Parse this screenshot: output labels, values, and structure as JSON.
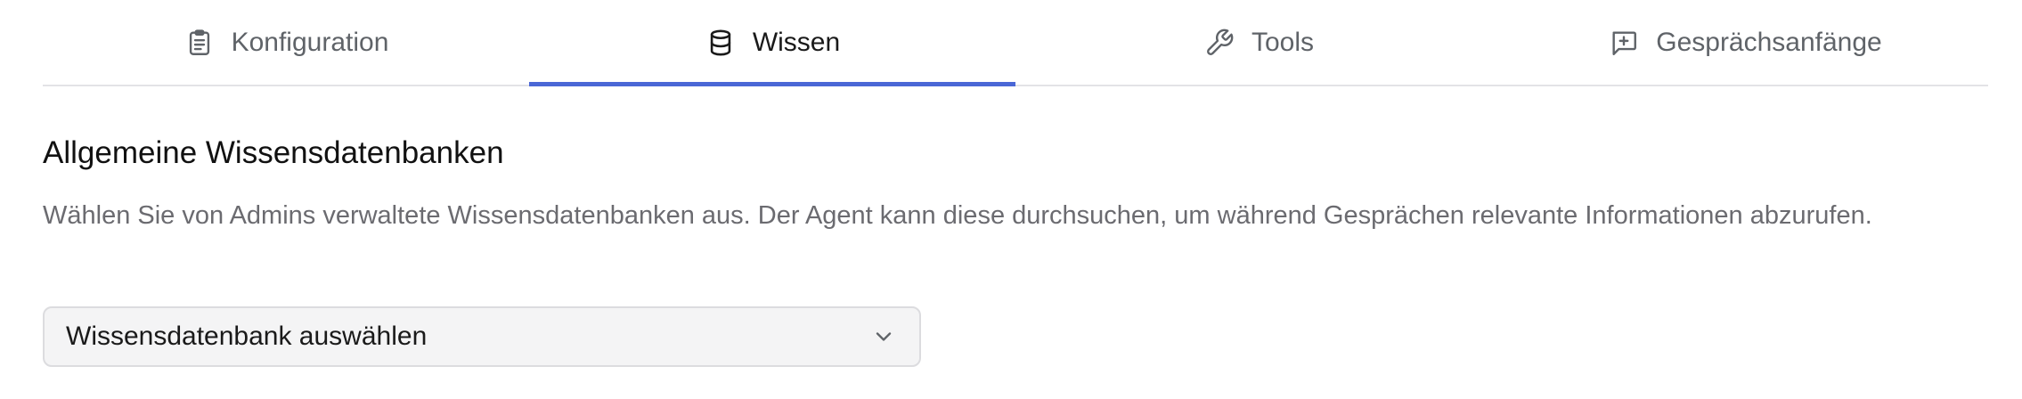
{
  "tabs": [
    {
      "label": "Konfiguration",
      "icon": "clipboard-icon",
      "active": false
    },
    {
      "label": "Wissen",
      "icon": "database-icon",
      "active": true
    },
    {
      "label": "Tools",
      "icon": "wrench-icon",
      "active": false
    },
    {
      "label": "Gesprächsanfänge",
      "icon": "message-plus-icon",
      "active": false
    }
  ],
  "section": {
    "title": "Allgemeine Wissensdatenbanken",
    "description": "Wählen Sie von Admins verwaltete Wissensdatenbanken aus. Der Agent kann diese durchsuchen, um während Gesprächen relevante Informationen abzurufen."
  },
  "select": {
    "value": "Wissensdatenbank auswählen",
    "icon": "chevron-down-icon"
  },
  "colors": {
    "accent": "#4a67d6",
    "muted_text": "#6b6b70"
  }
}
